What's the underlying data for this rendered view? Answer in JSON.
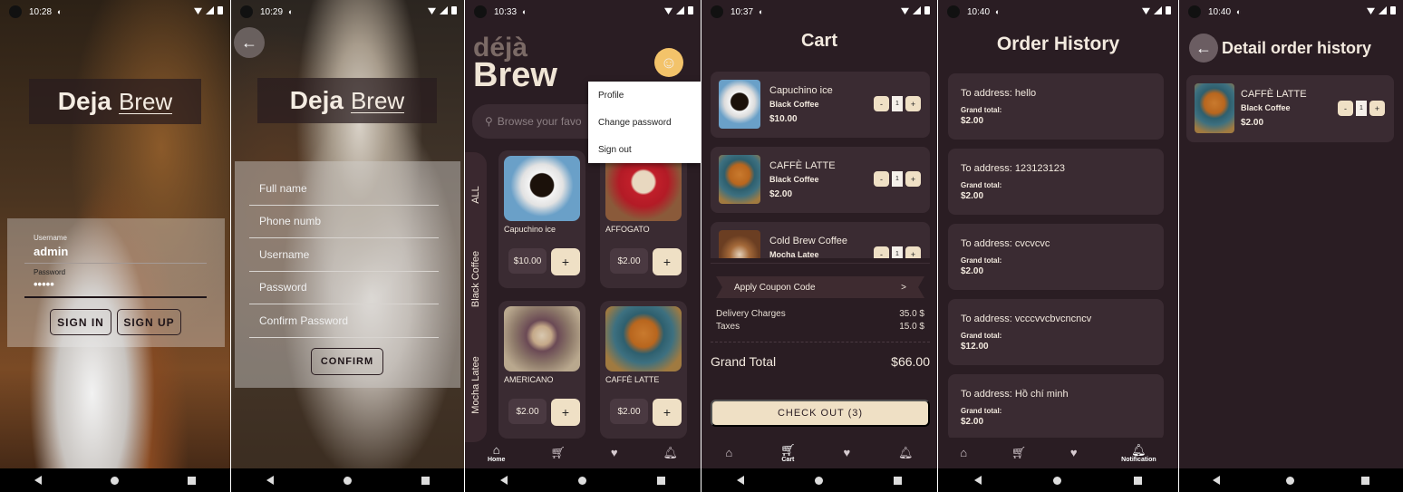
{
  "status": {
    "s1": "10:28",
    "s2": "10:29",
    "s3": "10:33",
    "s4": "10:37",
    "s5": "10:40",
    "s6": "10:40"
  },
  "brand": {
    "deja": "Deja",
    "brew": "Brew",
    "deja_accent": "déjà",
    "brew_big": "Brew"
  },
  "login": {
    "username_label": "Username",
    "username_value": "admin",
    "password_label": "Password",
    "password_value": "•••••",
    "signin": "SIGN IN",
    "signup": "SIGN UP"
  },
  "signup": {
    "fields": [
      "Full name",
      "Phone numb",
      "Username",
      "Password",
      "Confirm Password"
    ],
    "confirm": "CONFIRM"
  },
  "home": {
    "search_placeholder": "Browse your favo",
    "menu": [
      "Profile",
      "Change password",
      "Sign out"
    ],
    "categories": [
      "ALL",
      "Black Coffee",
      "Mocha Latee"
    ],
    "products": [
      {
        "name": "Capuchino ice",
        "price": "$10.00"
      },
      {
        "name": "AFFOGATO",
        "price": "$2.00"
      },
      {
        "name": "AMERICANO",
        "price": "$2.00"
      },
      {
        "name": "CAFFÈ LATTE",
        "price": "$2.00"
      }
    ],
    "nav": [
      "Home",
      "",
      "",
      ""
    ]
  },
  "cart": {
    "title": "Cart",
    "items": [
      {
        "name": "Capuchino ice",
        "sub": "Black Coffee",
        "price": "$10.00",
        "qty": "1"
      },
      {
        "name": "CAFFÈ LATTE",
        "sub": "Black Coffee",
        "price": "$2.00",
        "qty": "1"
      },
      {
        "name": "Cold Brew Coffee",
        "sub": "Mocha Latee",
        "price": "",
        "qty": "1"
      }
    ],
    "coupon": "Apply Coupon Code",
    "coupon_arrow": ">",
    "delivery_label": "Delivery Charges",
    "delivery_value": "35.0 $",
    "taxes_label": "Taxes",
    "taxes_value": "15.0 $",
    "grand_label": "Grand Total",
    "grand_value": "$66.00",
    "checkout": "CHECK OUT (3)",
    "nav": [
      "",
      "Cart",
      "",
      ""
    ]
  },
  "history": {
    "title": "Order History",
    "grand_label": "Grand total:",
    "orders": [
      {
        "address": "To address: hello",
        "total": "$2.00"
      },
      {
        "address": "To address: 123123123",
        "total": "$2.00"
      },
      {
        "address": "To address: cvcvcvc",
        "total": "$2.00"
      },
      {
        "address": "To address: vcccvvcbvcncncv",
        "total": "$12.00"
      },
      {
        "address": "To address: Hồ chí minh",
        "total": "$2.00"
      }
    ],
    "nav": [
      "",
      "",
      "",
      "Notification"
    ]
  },
  "detail": {
    "title": "Detail order history",
    "item": {
      "name": "CAFFÈ LATTE",
      "sub": "Black Coffee",
      "price": "$2.00",
      "qty": "1"
    }
  },
  "icons": {
    "back": "arrow-left-icon",
    "home": "home-icon",
    "cart": "cart-icon",
    "heart": "heart-icon",
    "bell": "bell-icon",
    "search": "search-icon"
  },
  "colors": {
    "bg": "#2a1d23",
    "card": "#3a2b32",
    "accent": "#efe0c5"
  }
}
